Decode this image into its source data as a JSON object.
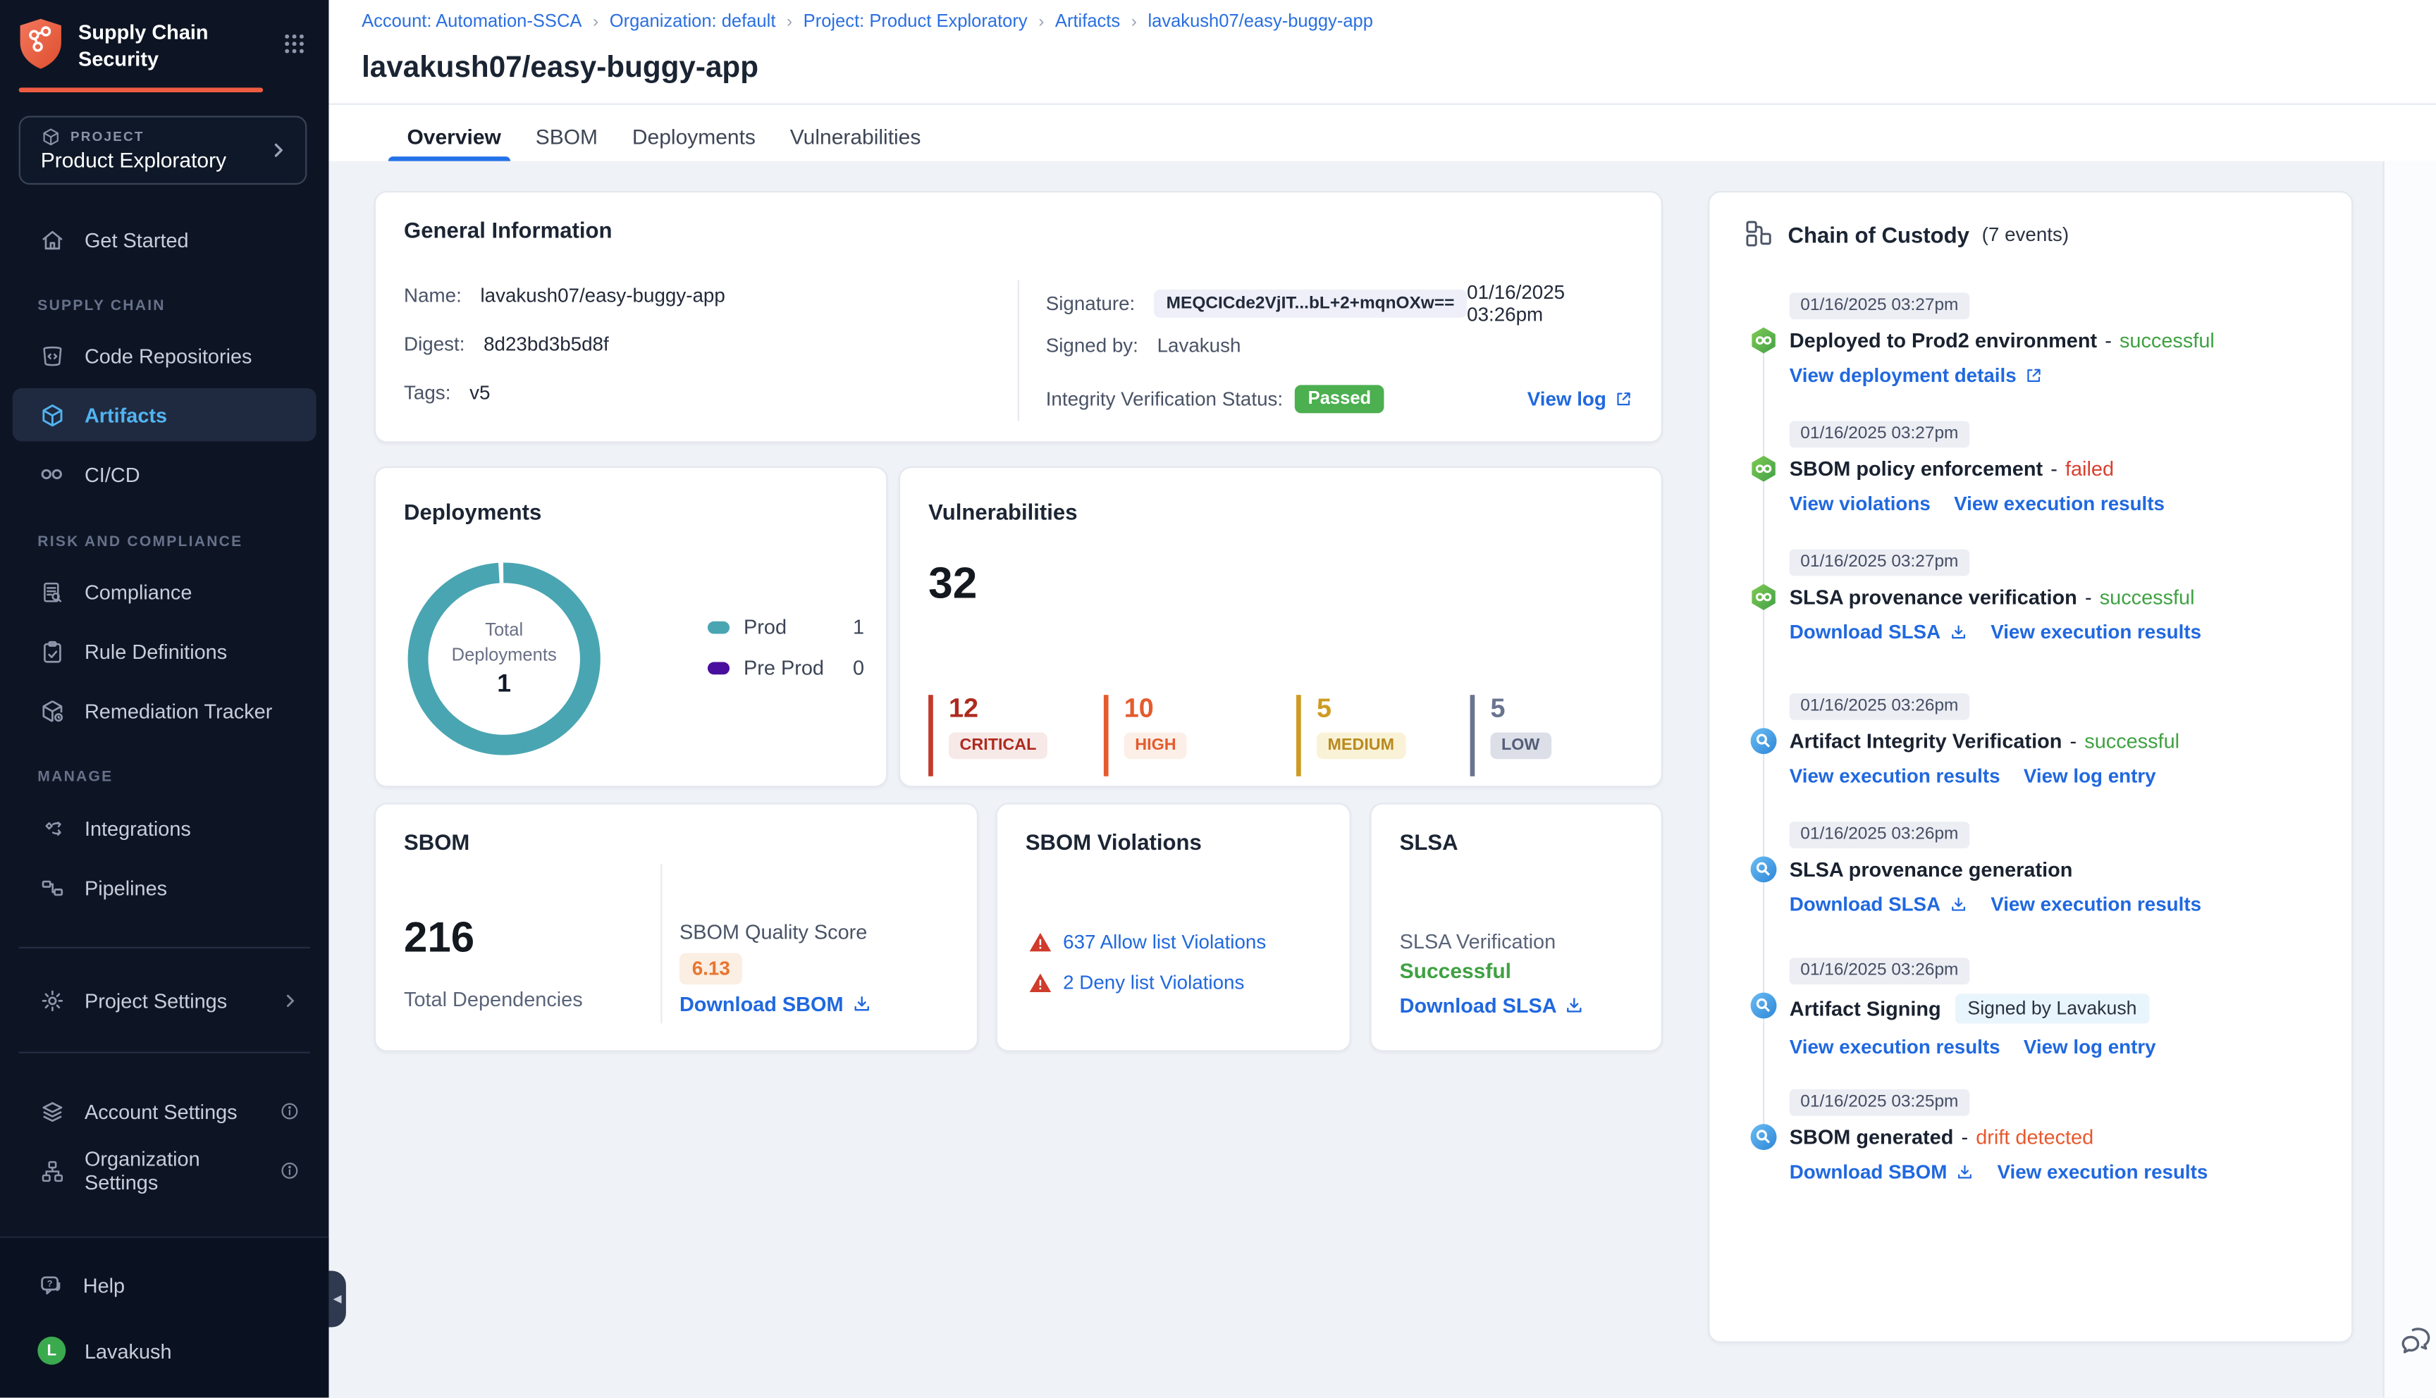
{
  "palette": {
    "accent_orange": "#EE5C42",
    "teal": "#4AA5B2",
    "preprod_purple": "#4A0E9E",
    "success_green": "#3FA142",
    "failed_red": "#D8402F",
    "drift_orange": "#E8582D",
    "link_blue": "#2068DF",
    "passed_badge_green": "#4CAF50",
    "critical": "#AE2A1F",
    "high": "#E55B2D",
    "medium": "#CE9B21",
    "low": "#69748F",
    "active_nav_blue": "#52B4F0",
    "sidebar_bg": "#0D1524"
  },
  "sidebar": {
    "app_title": "Supply Chain Security",
    "project": {
      "label": "PROJECT",
      "name": "Product Exploratory"
    },
    "get_started": "Get Started",
    "sections": {
      "supply_chain": "SUPPLY CHAIN",
      "risk": "RISK AND COMPLIANCE",
      "manage": "MANAGE"
    },
    "items": {
      "code_repositories": "Code Repositories",
      "artifacts": "Artifacts",
      "cicd": "CI/CD",
      "compliance": "Compliance",
      "rule_definitions": "Rule Definitions",
      "remediation_tracker": "Remediation Tracker",
      "integrations": "Integrations",
      "pipelines": "Pipelines",
      "project_settings": "Project Settings",
      "account_settings": "Account Settings",
      "organization_settings": "Organization Settings"
    },
    "footer": {
      "help": "Help",
      "user": "Lavakush",
      "avatar_initial": "L"
    }
  },
  "breadcrumb": {
    "separator": "›",
    "items": [
      "Account: Automation-SSCA",
      "Organization: default",
      "Project: Product Exploratory",
      "Artifacts",
      "lavakush07/easy-buggy-app"
    ]
  },
  "page_title": "lavakush07/easy-buggy-app",
  "tabs": [
    {
      "label": "Overview",
      "active": true
    },
    {
      "label": "SBOM",
      "active": false
    },
    {
      "label": "Deployments",
      "active": false
    },
    {
      "label": "Vulnerabilities",
      "active": false
    }
  ],
  "general_info": {
    "title": "General Information",
    "name_label": "Name:",
    "name": "lavakush07/easy-buggy-app",
    "digest_label": "Digest:",
    "digest": "8d23bd3b5d8f",
    "tags_label": "Tags:",
    "tags": "v5",
    "signature_label": "Signature:",
    "signature": "MEQCICde2VjIT...bL+2+mqnOXw==",
    "signature_time": "01/16/2025 03:26pm",
    "signed_by_label": "Signed by:",
    "signed_by": "Lavakush",
    "integrity_label": "Integrity Verification Status:",
    "integrity_status": "Passed",
    "view_log": "View log"
  },
  "deployments": {
    "title": "Deployments",
    "center_label_1": "Total",
    "center_label_2": "Deployments",
    "total": "1",
    "legend": [
      {
        "label": "Prod",
        "value": "1",
        "color": "#4AA5B2"
      },
      {
        "label": "Pre Prod",
        "value": "0",
        "color": "#4A0E9E"
      }
    ]
  },
  "vulnerabilities": {
    "title": "Vulnerabilities",
    "total": "32",
    "items": [
      {
        "count": "12",
        "label": "CRITICAL"
      },
      {
        "count": "10",
        "label": "HIGH"
      },
      {
        "count": "5",
        "label": "MEDIUM"
      },
      {
        "count": "5",
        "label": "LOW"
      }
    ]
  },
  "sbom": {
    "title": "SBOM",
    "total": "216",
    "total_label": "Total Dependencies",
    "quality_label": "SBOM Quality Score",
    "quality_score": "6.13",
    "download": "Download SBOM"
  },
  "sbom_violations": {
    "title": "SBOM Violations",
    "allow": "637 Allow list Violations",
    "deny": "2 Deny list Violations"
  },
  "slsa": {
    "title": "SLSA",
    "verification_label": "SLSA Verification",
    "status": "Successful",
    "download": "Download SLSA"
  },
  "chain": {
    "title": "Chain of Custody",
    "events_count": "(7 events)",
    "events": [
      {
        "time": "01/16/2025 03:27pm",
        "title": "Deployed to Prod2 environment",
        "sep": "-",
        "status": "successful",
        "links": [
          {
            "label": "View deployment details"
          }
        ]
      },
      {
        "time": "01/16/2025 03:27pm",
        "title": "SBOM policy enforcement",
        "sep": "-",
        "status": "failed",
        "links": [
          {
            "label": "View violations"
          },
          {
            "label": "View execution results"
          }
        ]
      },
      {
        "time": "01/16/2025 03:27pm",
        "title": "SLSA provenance verification",
        "sep": "-",
        "status": "successful",
        "links": [
          {
            "label": "Download SLSA"
          },
          {
            "label": "View execution results"
          }
        ]
      },
      {
        "time": "01/16/2025 03:26pm",
        "title": "Artifact Integrity Verification",
        "sep": "-",
        "status": "successful",
        "links": [
          {
            "label": "View execution results"
          },
          {
            "label": "View log entry"
          }
        ]
      },
      {
        "time": "01/16/2025 03:26pm",
        "title": "SLSA provenance generation",
        "links": [
          {
            "label": "Download SLSA"
          },
          {
            "label": "View execution results"
          }
        ]
      },
      {
        "time": "01/16/2025 03:26pm",
        "title": "Artifact Signing",
        "badge": "Signed by Lavakush",
        "links": [
          {
            "label": "View execution results"
          },
          {
            "label": "View log entry"
          }
        ]
      },
      {
        "time": "01/16/2025 03:25pm",
        "title": "SBOM generated",
        "sep": "-",
        "status": "drift detected",
        "links": [
          {
            "label": "Download SBOM"
          },
          {
            "label": "View execution results"
          }
        ]
      }
    ]
  }
}
